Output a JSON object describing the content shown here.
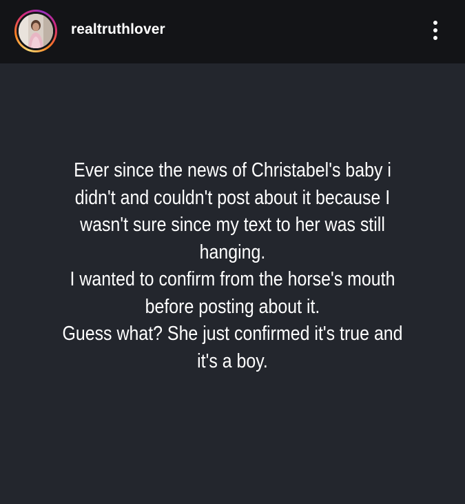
{
  "header": {
    "username": "realtruthlover",
    "avatar_icon": "profile-photo-avatar",
    "more_icon": "more-vertical-icon",
    "ring_colors": [
      "#feda75",
      "#fa7e1e",
      "#d62976",
      "#962fbf"
    ]
  },
  "story": {
    "background": "#23262d",
    "text_color": "#ffffff",
    "lines": [
      "Ever since the news of Christabel's baby i",
      "didn't and couldn't post about it because I",
      "wasn't sure since my text to her was still",
      "hanging.",
      "I wanted to confirm from the horse's mouth",
      "before posting about it.",
      "Guess what? She just confirmed it's true and",
      "it's a boy."
    ]
  }
}
